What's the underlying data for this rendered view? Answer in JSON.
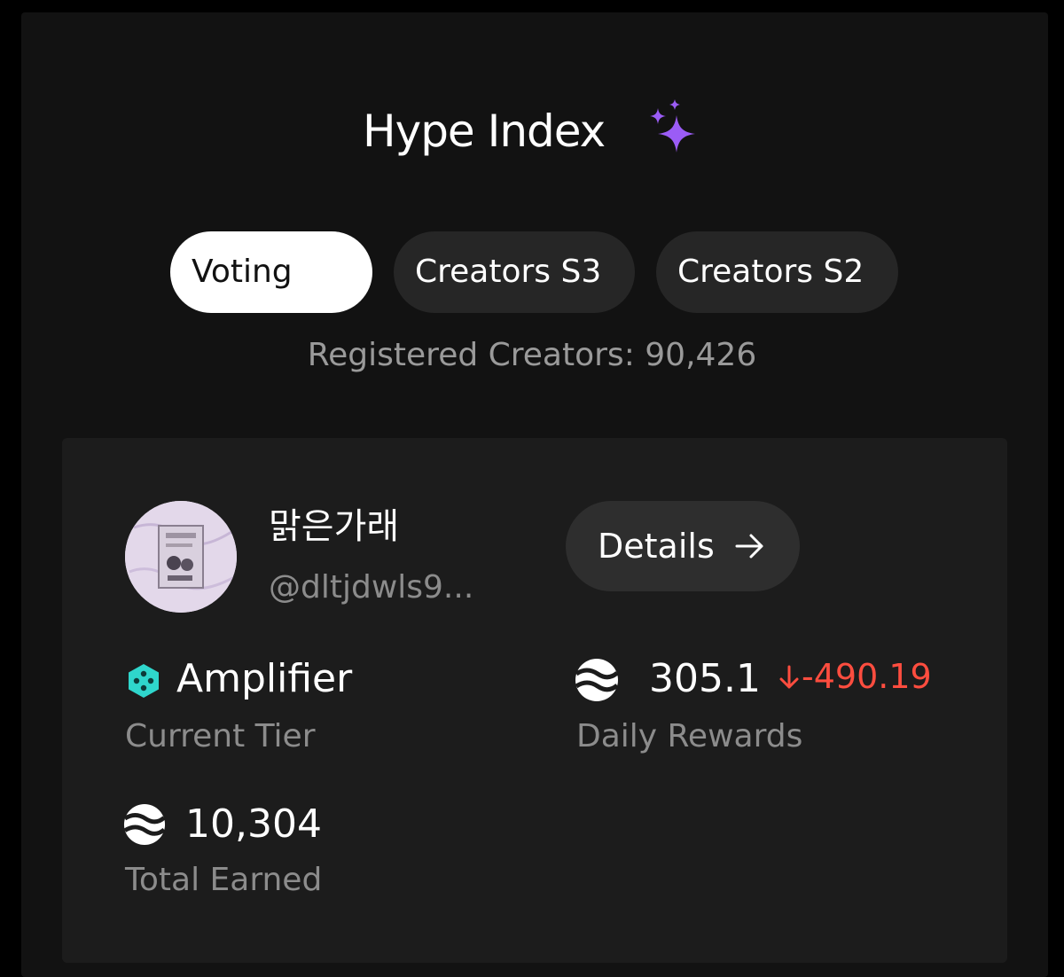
{
  "header": {
    "title": "Hype Index",
    "title_icon": "sparkle-icon",
    "accent_color": "#9b5cf6"
  },
  "tabs": [
    {
      "label": "Voting",
      "active": true
    },
    {
      "label": "Creators S3",
      "active": false
    },
    {
      "label": "Creators S2",
      "active": false
    }
  ],
  "registered_text": "Registered Creators: 90,426",
  "creator": {
    "name": "맑은가래",
    "handle": "@dltjdwls9...",
    "details_label": "Details",
    "details_icon": "arrow-right-icon"
  },
  "stats": {
    "tier": {
      "value": "Amplifier",
      "label": "Current Tier",
      "icon": "hexagon-tier-icon",
      "icon_color": "#2fd6cc"
    },
    "daily": {
      "value": "305.1",
      "delta": "-490.19",
      "label": "Daily Rewards",
      "icon": "token-icon",
      "delta_color": "#ff4d3f"
    },
    "total": {
      "value": "10,304",
      "label": "Total Earned",
      "icon": "token-icon"
    }
  }
}
